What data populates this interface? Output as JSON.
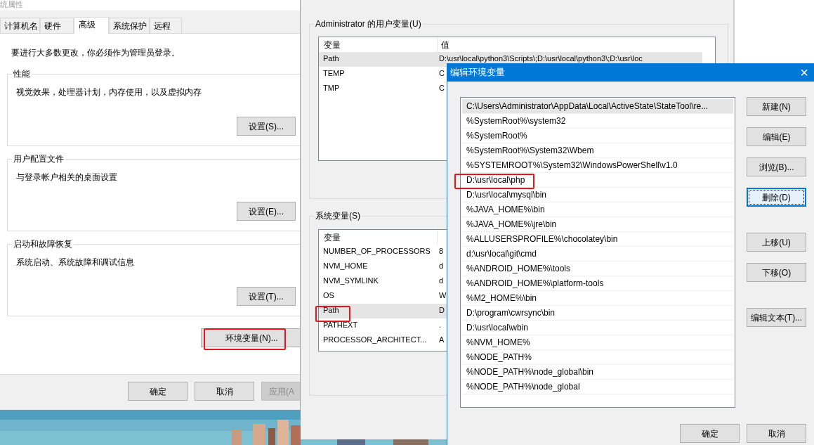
{
  "system_properties": {
    "title": "统属性",
    "tabs": [
      {
        "label": "计算机名",
        "selected": false
      },
      {
        "label": "硬件",
        "selected": false
      },
      {
        "label": "高级",
        "selected": true
      },
      {
        "label": "系统保护",
        "selected": false
      },
      {
        "label": "远程",
        "selected": false
      }
    ],
    "notice": "要进行大多数更改，你必须作为管理员登录。",
    "groups": [
      {
        "title": "性能",
        "description": "视觉效果，处理器计划，内存使用，以及虚拟内存",
        "button": "设置(S)..."
      },
      {
        "title": "用户配置文件",
        "description": "与登录帐户相关的桌面设置",
        "button": "设置(E)..."
      },
      {
        "title": "启动和故障恢复",
        "description": "系统启动、系统故障和调试信息",
        "button": "设置(T)..."
      }
    ],
    "env_button": {
      "label": "环境变量(N)...",
      "highlighted": true
    },
    "buttons": [
      {
        "label": "确定",
        "disabled": false
      },
      {
        "label": "取消",
        "disabled": false
      },
      {
        "label": "应用(A",
        "disabled": true
      }
    ]
  },
  "environment_variables": {
    "user_group": {
      "title": "Administrator 的用户变量(U)",
      "columns": [
        "变量",
        "值"
      ],
      "rows": [
        {
          "name": "Path",
          "value": "D:\\usr\\local\\python3\\Scripts\\;D:\\usr\\local\\python3\\;D:\\usr\\loc",
          "selected": true,
          "highlighted": false
        },
        {
          "name": "TEMP",
          "value": "C",
          "selected": false,
          "highlighted": false
        },
        {
          "name": "TMP",
          "value": "C",
          "selected": false,
          "highlighted": false
        }
      ]
    },
    "system_group": {
      "title": "系统变量(S)",
      "columns": [
        "变量"
      ],
      "rows": [
        {
          "name": "NUMBER_OF_PROCESSORS",
          "value": "8",
          "selected": false,
          "highlighted": false
        },
        {
          "name": "NVM_HOME",
          "value": "d",
          "selected": false,
          "highlighted": false
        },
        {
          "name": "NVM_SYMLINK",
          "value": "d",
          "selected": false,
          "highlighted": false
        },
        {
          "name": "OS",
          "value": "W",
          "selected": false,
          "highlighted": false
        },
        {
          "name": "Path",
          "value": "D",
          "selected": true,
          "highlighted": true
        },
        {
          "name": "PATHEXT",
          "value": ".",
          "selected": false,
          "highlighted": false
        },
        {
          "name": "PROCESSOR_ARCHITECT...",
          "value": "A",
          "selected": false,
          "highlighted": false
        }
      ]
    }
  },
  "edit_dialog": {
    "title": "编辑环境变量",
    "close": "×",
    "paths": [
      {
        "text": "C:\\Users\\Administrator\\AppData\\Local\\ActiveState\\StateTool\\re...",
        "selected": true,
        "highlighted": false
      },
      {
        "text": "%SystemRoot%\\system32",
        "selected": false,
        "highlighted": false
      },
      {
        "text": "%SystemRoot%",
        "selected": false,
        "highlighted": false
      },
      {
        "text": "%SystemRoot%\\System32\\Wbem",
        "selected": false,
        "highlighted": false
      },
      {
        "text": "%SYSTEMROOT%\\System32\\WindowsPowerShell\\v1.0",
        "selected": false,
        "highlighted": false
      },
      {
        "text": "D:\\usr\\local\\php",
        "selected": false,
        "highlighted": true
      },
      {
        "text": "D:\\usr\\local\\mysql\\bin",
        "selected": false,
        "highlighted": false
      },
      {
        "text": "%JAVA_HOME%\\bin",
        "selected": false,
        "highlighted": false
      },
      {
        "text": "%JAVA_HOME%\\jre\\bin",
        "selected": false,
        "highlighted": false
      },
      {
        "text": "%ALLUSERSPROFILE%\\chocolatey\\bin",
        "selected": false,
        "highlighted": false
      },
      {
        "text": "d:\\usr\\local\\git\\cmd",
        "selected": false,
        "highlighted": false
      },
      {
        "text": "%ANDROID_HOME%\\tools",
        "selected": false,
        "highlighted": false
      },
      {
        "text": "%ANDROID_HOME%\\platform-tools",
        "selected": false,
        "highlighted": false
      },
      {
        "text": "%M2_HOME%\\bin",
        "selected": false,
        "highlighted": false
      },
      {
        "text": "D:\\program\\cwrsync\\bin",
        "selected": false,
        "highlighted": false
      },
      {
        "text": "D:\\usr\\local\\wbin",
        "selected": false,
        "highlighted": false
      },
      {
        "text": "%NVM_HOME%",
        "selected": false,
        "highlighted": false
      },
      {
        "text": "%NODE_PATH%",
        "selected": false,
        "highlighted": false
      },
      {
        "text": "%NODE_PATH%\\node_global\\bin",
        "selected": false,
        "highlighted": false
      },
      {
        "text": "%NODE_PATH%\\node_global",
        "selected": false,
        "highlighted": false
      }
    ],
    "side_button_groups": [
      [
        {
          "label": "新建(N)",
          "focused": false
        },
        {
          "label": "编辑(E)",
          "focused": false
        },
        {
          "label": "浏览(B)...",
          "focused": false
        },
        {
          "label": "删除(D)",
          "focused": true
        }
      ],
      [
        {
          "label": "上移(U)",
          "focused": false
        },
        {
          "label": "下移(O)",
          "focused": false
        }
      ],
      [
        {
          "label": "编辑文本(T)...",
          "focused": false
        }
      ]
    ],
    "buttons": [
      "确定",
      "取消"
    ]
  }
}
